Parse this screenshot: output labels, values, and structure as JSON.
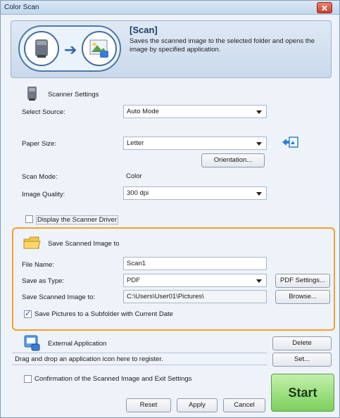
{
  "window": {
    "title": "Color Scan"
  },
  "banner": {
    "heading": "[Scan]",
    "description": "Saves the scanned image to the selected folder and opens the image by specified application."
  },
  "scanner": {
    "section_label": "Scanner Settings",
    "select_source_label": "Select Source:",
    "select_source_value": "Auto Mode",
    "paper_size_label": "Paper Size:",
    "paper_size_value": "Letter",
    "orientation_button": "Orientation...",
    "scan_mode_label": "Scan Mode:",
    "scan_mode_value": "Color",
    "image_quality_label": "Image Quality:",
    "image_quality_value": "300 dpi",
    "display_driver_label": "Display the Scanner Driver",
    "display_driver_checked": false
  },
  "save": {
    "section_label": "Save Scanned Image to",
    "file_name_label": "File Name:",
    "file_name_value": "Scan1",
    "save_as_type_label": "Save as Type:",
    "save_as_type_value": "PDF",
    "pdf_settings_button": "PDF Settings...",
    "save_location_label": "Save Scanned Image to:",
    "save_location_value": "C:\\Users\\User01\\Pictures\\",
    "browse_button": "Browse...",
    "subfolder_label": "Save Pictures to a Subfolder with Current Date",
    "subfolder_checked": true
  },
  "external": {
    "section_label": "External Application",
    "delete_button": "Delete",
    "drop_hint": "Drag and drop an application icon here to register.",
    "set_button": "Set..."
  },
  "footer": {
    "confirm_label": "Confirmation of the Scanned Image and Exit Settings",
    "confirm_checked": false,
    "reset_button": "Reset",
    "apply_button": "Apply",
    "cancel_button": "Cancel",
    "start_button": "Start"
  },
  "colors": {
    "highlight": "#f3a02c",
    "start_green": "#7cd05c",
    "titlebar": "#c3d6ec"
  }
}
